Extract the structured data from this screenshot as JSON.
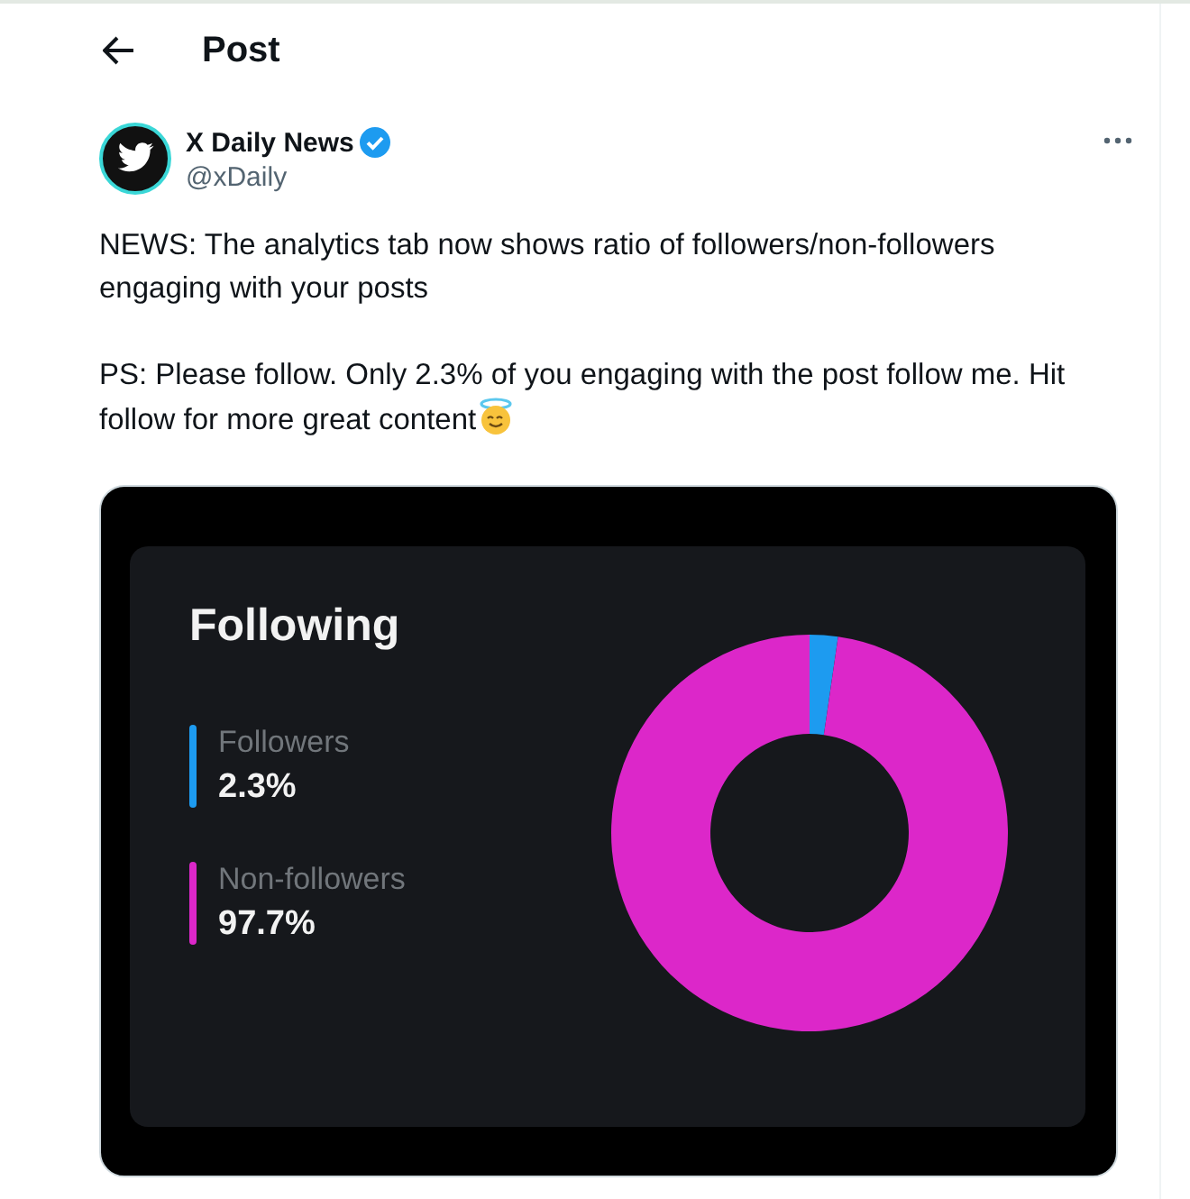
{
  "header": {
    "title": "Post"
  },
  "post": {
    "author": "X Daily News",
    "verified": true,
    "handle": "@xDaily",
    "paragraphs": [
      "NEWS: The analytics tab now shows ratio of followers/non-followers engaging with your posts",
      "PS: Please follow. Only 2.3% of you engaging with the post follow me. Hit follow for more great content"
    ],
    "media": {
      "title": "Following",
      "legend": [
        {
          "value": "2.3%",
          "color": "#1d9bf0"
        },
        {
          "value": "97.7%",
          "color": "#dc27c9"
        }
      ],
      "chart_data": {
        "type": "donut",
        "categories": [
          "Followers",
          "Non-followers"
        ],
        "values": [
          2.3,
          97.7
        ]
      }
    }
  }
}
